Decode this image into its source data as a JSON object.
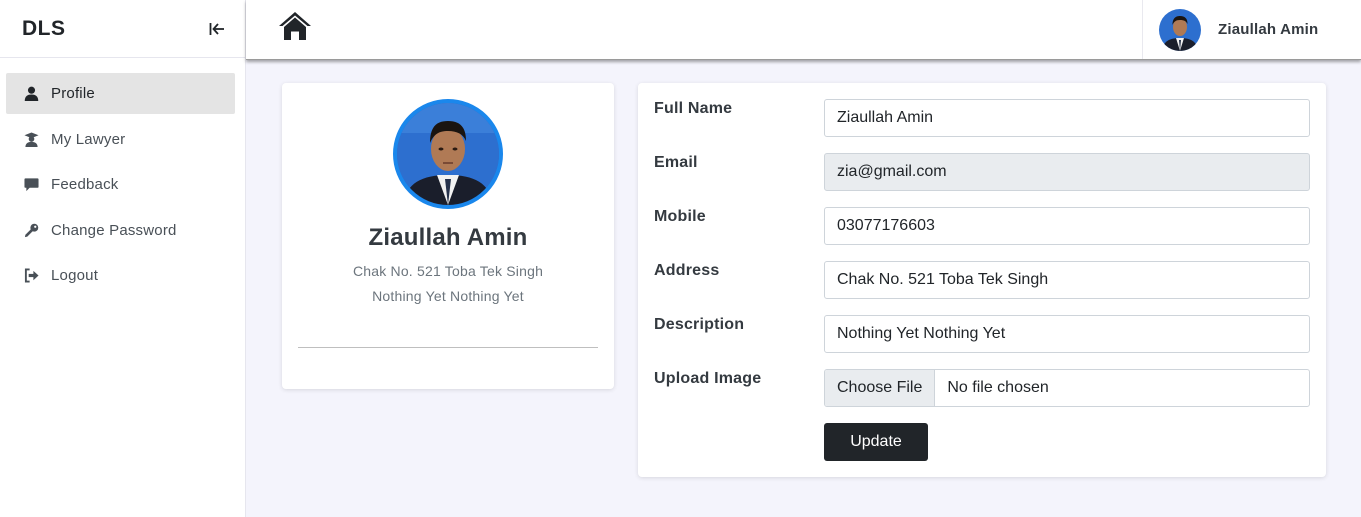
{
  "sidebar": {
    "brand": "DLS",
    "items": [
      {
        "label": "Profile",
        "icon": "user-icon",
        "active": true
      },
      {
        "label": "My Lawyer",
        "icon": "lawyer-icon",
        "active": false
      },
      {
        "label": "Feedback",
        "icon": "comment-icon",
        "active": false
      },
      {
        "label": "Change Password",
        "icon": "key-icon",
        "active": false
      },
      {
        "label": "Logout",
        "icon": "logout-icon",
        "active": false
      }
    ]
  },
  "topbar": {
    "home_icon": "home-icon",
    "user_name": "Ziaullah Amin"
  },
  "profile_card": {
    "name": "Ziaullah Amin",
    "address": "Chak No. 521 Toba Tek Singh",
    "description": "Nothing Yet Nothing Yet",
    "avatar_border_color": "#1a87ec"
  },
  "form": {
    "full_name_label": "Full Name",
    "full_name_value": "Ziaullah Amin",
    "email_label": "Email",
    "email_value": "zia@gmail.com",
    "mobile_label": "Mobile",
    "mobile_value": "03077176603",
    "address_label": "Address",
    "address_value": "Chak No. 521 Toba Tek Singh",
    "description_label": "Description",
    "description_value": "Nothing Yet Nothing Yet",
    "upload_label": "Upload Image",
    "choose_file_label": "Choose File",
    "file_status": "No file chosen",
    "update_label": "Update"
  },
  "colors": {
    "accent": "#1a87ec",
    "dark_button": "#212529",
    "page_background": "#f4f4fc"
  }
}
